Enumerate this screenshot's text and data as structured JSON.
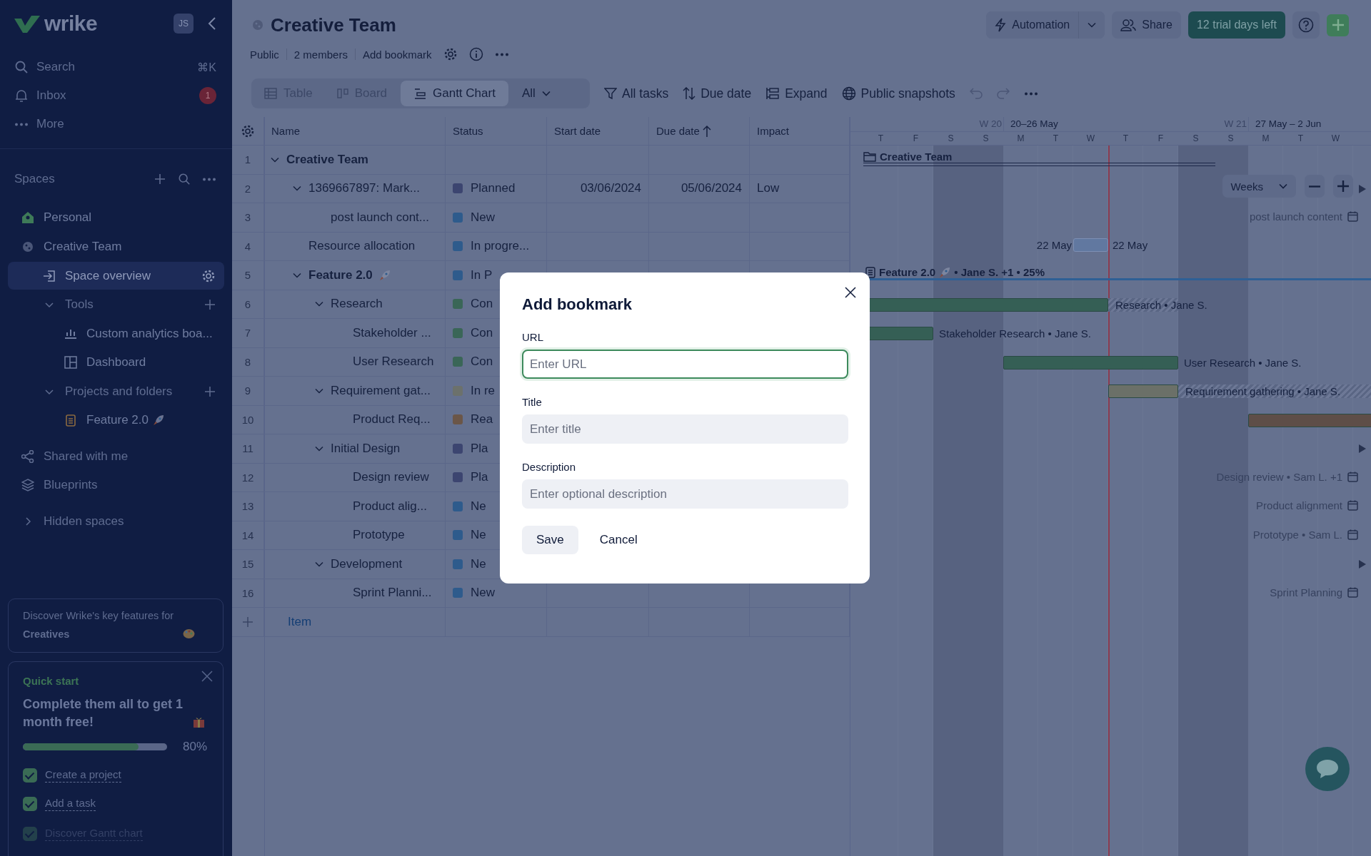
{
  "sidebar": {
    "logo": "wrike",
    "avatar": "JS",
    "nav": [
      {
        "label": "Search",
        "kind": "search",
        "shortcut": "⌘K"
      },
      {
        "label": "Inbox",
        "kind": "inbox",
        "badge": "1"
      },
      {
        "label": "More",
        "kind": "more"
      }
    ],
    "spaces_title": "Spaces",
    "tree": [
      {
        "label": "Personal",
        "kind": "home",
        "selected": false
      },
      {
        "label": "Creative Team",
        "kind": "team",
        "selected": false,
        "expanded": true,
        "children": [
          {
            "label": "Space overview",
            "kind": "overview",
            "selected": true
          },
          {
            "label": "Tools",
            "kind": "section",
            "expanded": true,
            "children": [
              {
                "label": "Custom analytics boa...",
                "kind": "analytics",
                "selected": false
              },
              {
                "label": "Dashboard",
                "kind": "dashboard",
                "selected": false
              }
            ]
          },
          {
            "label": "Projects and folders",
            "kind": "section",
            "expanded": true,
            "children": [
              {
                "label": "Feature 2.0",
                "kind": "project",
                "rocket": true,
                "selected": false
              }
            ]
          }
        ]
      },
      {
        "label": "Shared with me",
        "kind": "shared",
        "selected": false
      },
      {
        "label": "Blueprints",
        "kind": "blueprints",
        "selected": false
      },
      {
        "label": "Hidden spaces",
        "kind": "collapsed",
        "expanded": false
      }
    ],
    "promo": "Discover Wrike's key features for **Creatives**",
    "quick_start": {
      "title": "Quick start",
      "heading": "Complete them all to get 1 month free!",
      "level": 0.8,
      "percent": "80%",
      "tasks": [
        {
          "label": "Create a project",
          "checked": true
        },
        {
          "label": "Add a task",
          "checked": true
        },
        {
          "label": "Discover Gantt chart",
          "checked": true
        }
      ]
    }
  },
  "header": {
    "title": "Creative Team",
    "meta": [
      "Public",
      "2 members",
      "Add bookmark"
    ],
    "automation": "Automation",
    "share": "Share",
    "trial": "12 trial days left"
  },
  "views": [
    {
      "label": "Table",
      "kind": "table",
      "selected": false
    },
    {
      "label": "Board",
      "kind": "board",
      "selected": false
    },
    {
      "label": "Gantt Chart",
      "kind": "gantt",
      "selected": true
    }
  ],
  "view_filter": "All",
  "toolbar": [
    {
      "label": "All tasks",
      "kind": "filter"
    },
    {
      "label": "Due date",
      "kind": "sort"
    },
    {
      "label": "Expand",
      "kind": "expand"
    },
    {
      "label": "Public snapshots",
      "kind": "globe"
    }
  ],
  "table": {
    "columns": [
      "Name",
      "Status",
      "Start date",
      "Due date",
      "Impact"
    ],
    "rows": [
      {
        "num": "1",
        "name": "Creative Team",
        "kind": "folder",
        "expanded": true,
        "children": [
          {
            "num": "2",
            "name": "1369667897: Mark...",
            "expanded": true,
            "status": "Planned",
            "color": "#3c4570",
            "start": "03/06/2024",
            "due": "05/06/2024",
            "impact": "Low",
            "children": [
              {
                "num": "3",
                "name": "post launch cont...",
                "status": "New",
                "color": "#2e5b8c"
              }
            ]
          },
          {
            "num": "4",
            "name": "Resource allocation",
            "status": "In progre...",
            "color": "#2e5b8c"
          },
          {
            "num": "5",
            "name": "Feature 2.0",
            "kind": "project",
            "rocket": true,
            "expanded": true,
            "status": "In P",
            "color": "#2e5b8c",
            "children": [
              {
                "num": "6",
                "name": "Research",
                "expanded": true,
                "status": "Con",
                "color": "#3a6657",
                "children": [
                  {
                    "num": "7",
                    "name": "Stakeholder ...",
                    "status": "Con",
                    "color": "#3a6657"
                  },
                  {
                    "num": "8",
                    "name": "User Research",
                    "status": "Con",
                    "color": "#3a6657"
                  }
                ]
              },
              {
                "num": "9",
                "name": "Requirement gat...",
                "expanded": true,
                "status": "In re",
                "color": "#6c716c",
                "children": [
                  {
                    "num": "10",
                    "name": "Product Req...",
                    "status": "Rea",
                    "color": "#6b5648"
                  }
                ]
              },
              {
                "num": "11",
                "name": "Initial Design",
                "expanded": true,
                "status": "Pla",
                "color": "#3c4570",
                "children": [
                  {
                    "num": "12",
                    "name": "Design review",
                    "status": "Pla",
                    "color": "#3c4570"
                  },
                  {
                    "num": "13",
                    "name": "Product alig...",
                    "status": "Ne",
                    "color": "#2e5b8c"
                  },
                  {
                    "num": "14",
                    "name": "Prototype",
                    "status": "Ne",
                    "color": "#2e5b8c"
                  }
                ]
              },
              {
                "num": "15",
                "name": "Development",
                "expanded": true,
                "status": "Ne",
                "color": "#2e5b8c",
                "children": [
                  {
                    "num": "16",
                    "name": "Sprint Planni...",
                    "status": "New",
                    "color": "#2e5b8c"
                  }
                ]
              }
            ]
          }
        ]
      }
    ],
    "new_item": "Item"
  },
  "gantt": {
    "weeks": [
      {
        "number": "W 20",
        "range": "20–26 May"
      },
      {
        "number": "W 21",
        "range": "27 May – 2 Jun"
      }
    ],
    "days": [
      {
        "label": "T",
        "weekend": false
      },
      {
        "label": "F",
        "weekend": false
      },
      {
        "label": "S",
        "weekend": true
      },
      {
        "label": "S",
        "weekend": true
      },
      {
        "label": "M",
        "weekend": false
      },
      {
        "label": "T",
        "weekend": false
      },
      {
        "label": "W",
        "weekend": false
      },
      {
        "label": "T",
        "weekend": false
      },
      {
        "label": "F",
        "weekend": false
      },
      {
        "label": "S",
        "weekend": true
      },
      {
        "label": "S",
        "weekend": true
      },
      {
        "label": "M",
        "weekend": false
      },
      {
        "label": "T",
        "weekend": false
      },
      {
        "label": "W",
        "weekend": false
      }
    ],
    "scale": "Weeks",
    "rows": [
      {
        "kind": "group",
        "label": "Creative Team"
      },
      {
        "kind": "arrow"
      },
      {
        "kind": "milestone",
        "label": "post launch content"
      },
      {
        "kind": "dated",
        "left": "22 May",
        "right": "22 May"
      },
      {
        "kind": "summary",
        "label": "Feature 2.0",
        "rocket": true,
        "info": "• Jane S. +1 • 25%"
      },
      {
        "kind": "bar",
        "label": "Research • Jane S.",
        "color": "#355f55"
      },
      {
        "kind": "bar",
        "label": "Stakeholder Research • Jane S.",
        "color": "#355f55"
      },
      {
        "kind": "bar",
        "label": "User Research • Jane S.",
        "color": "#355f55"
      },
      {
        "kind": "bar",
        "label": "Requirement gathering • Jane S.",
        "color": "#6b7068"
      },
      {
        "kind": "bar",
        "color": "#5e4e48"
      },
      {
        "kind": "arrow"
      },
      {
        "kind": "milestone",
        "label": "Design review • Sam L. +1"
      },
      {
        "kind": "milestone",
        "label": "Product alignment"
      },
      {
        "kind": "milestone",
        "label": "Prototype • Sam L."
      },
      {
        "kind": "arrow"
      },
      {
        "kind": "milestone",
        "label": "Sprint Planning"
      }
    ]
  },
  "modal": {
    "title": "Add bookmark",
    "fields": [
      {
        "label": "URL",
        "placeholder": "Enter URL",
        "focused": true
      },
      {
        "label": "Title",
        "placeholder": "Enter title",
        "focused": false
      },
      {
        "label": "Description",
        "placeholder": "Enter optional description",
        "focused": false
      }
    ],
    "save": "Save",
    "cancel": "Cancel"
  }
}
